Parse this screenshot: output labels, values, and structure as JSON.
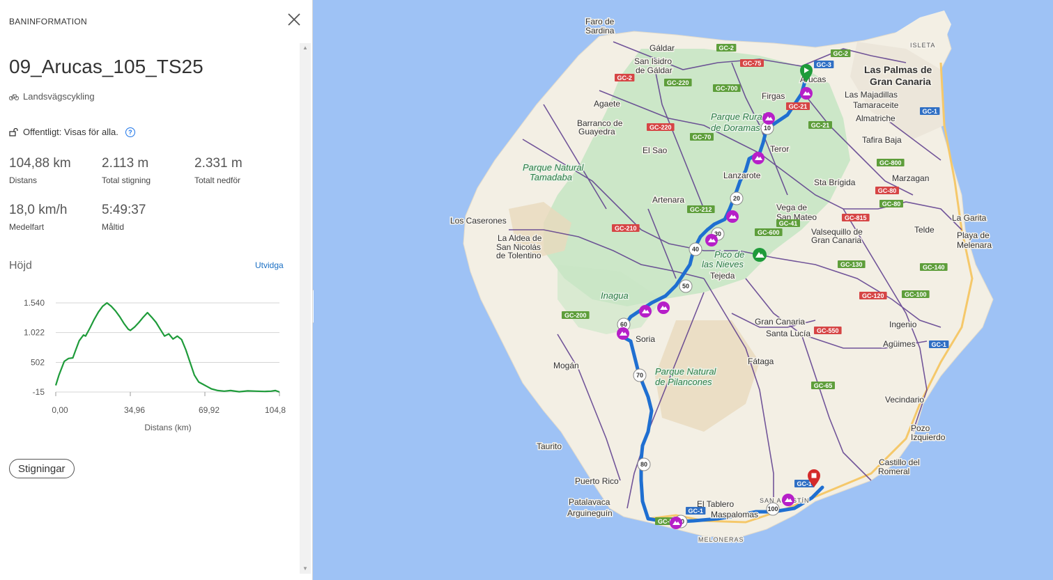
{
  "panel": {
    "header": "BANINFORMATION",
    "route_name": "09_Arucas_105_TS25",
    "activity": "Landsvägscykling",
    "visibility": "Offentligt: Visas för alla.",
    "stats": [
      {
        "value": "104,88 km",
        "label": "Distans"
      },
      {
        "value": "2.113 m",
        "label": "Total stigning"
      },
      {
        "value": "2.331 m",
        "label": "Totalt nedför"
      },
      {
        "value": "18,0 km/h",
        "label": "Medelfart"
      },
      {
        "value": "5:49:37",
        "label": "Måltid"
      }
    ],
    "elevation_title": "Höjd",
    "expand_label": "Utvidga",
    "climbs_button": "Stigningar"
  },
  "chart_data": {
    "type": "line",
    "title": "",
    "xlabel": "Distans (km)",
    "ylabel": "",
    "y_ticks": [
      "1.540",
      "1.022",
      "502",
      "-15"
    ],
    "x_ticks": [
      "0,00",
      "34,96",
      "69,92",
      "104,8"
    ],
    "xlim": [
      0,
      104.88
    ],
    "ylim": [
      -15,
      1540
    ],
    "line_color": "#1e9b3a",
    "series": [
      {
        "x": [
          0,
          1.5,
          4,
          6,
          8,
          9,
          11,
          13,
          14,
          16,
          18,
          20,
          22,
          24,
          26,
          28,
          30,
          32,
          34,
          35,
          37,
          39,
          41,
          43,
          45,
          47,
          49,
          51,
          53,
          55,
          57,
          59,
          61,
          63,
          65,
          67,
          69,
          71,
          73,
          76,
          79,
          82,
          86,
          90,
          94,
          98,
          101,
          103,
          104.88
        ],
        "y": [
          100,
          280,
          520,
          570,
          580,
          680,
          880,
          980,
          960,
          1100,
          1250,
          1380,
          1480,
          1540,
          1480,
          1400,
          1300,
          1180,
          1080,
          1060,
          1120,
          1200,
          1290,
          1370,
          1290,
          1200,
          1080,
          960,
          1000,
          910,
          960,
          900,
          720,
          500,
          280,
          160,
          120,
          80,
          40,
          10,
          0,
          10,
          -10,
          5,
          0,
          -5,
          0,
          10,
          -15
        ]
      }
    ]
  },
  "map": {
    "labels": [
      {
        "t": "Faro de",
        "c": "town"
      },
      {
        "t": "Sardina",
        "c": "town"
      },
      {
        "t": "Gáldar",
        "c": "town"
      },
      {
        "t": "San Isidro",
        "c": "town"
      },
      {
        "t": "de Gáldar",
        "c": "town"
      },
      {
        "t": "Agaete",
        "c": "town"
      },
      {
        "t": "Barranco de",
        "c": "town"
      },
      {
        "t": "Guayedra",
        "c": "town"
      },
      {
        "t": "El Sao",
        "c": "town"
      },
      {
        "t": "Firgas",
        "c": "town"
      },
      {
        "t": "Arucas",
        "c": "town"
      },
      {
        "t": "Las Palmas de",
        "c": "city"
      },
      {
        "t": "Gran Canaria",
        "c": "city"
      },
      {
        "t": "ISLETA",
        "c": "caps"
      },
      {
        "t": "Las Majadillas",
        "c": "town"
      },
      {
        "t": "Tamaraceite",
        "c": "town"
      },
      {
        "t": "Almatriche",
        "c": "town"
      },
      {
        "t": "Tafira Baja",
        "c": "town"
      },
      {
        "t": "Parque Rural",
        "c": "park"
      },
      {
        "t": "de Doramas",
        "c": "park"
      },
      {
        "t": "Parque Natural",
        "c": "park"
      },
      {
        "t": "Tamadaba",
        "c": "park"
      },
      {
        "t": "Teror",
        "c": "town"
      },
      {
        "t": "Lanzarote",
        "c": "town"
      },
      {
        "t": "Sta Brígida",
        "c": "town"
      },
      {
        "t": "Marzagan",
        "c": "town"
      },
      {
        "t": "Artenara",
        "c": "town"
      },
      {
        "t": "Vega de",
        "c": "town"
      },
      {
        "t": "San Mateo",
        "c": "town"
      },
      {
        "t": "Valsequillo de",
        "c": "town"
      },
      {
        "t": "Gran Canaria",
        "c": "town"
      },
      {
        "t": "Telde",
        "c": "town"
      },
      {
        "t": "La Garita",
        "c": "town"
      },
      {
        "t": "Playa de",
        "c": "town"
      },
      {
        "t": "Melenara",
        "c": "town"
      },
      {
        "t": "Los Caserones",
        "c": "town"
      },
      {
        "t": "La Aldea de",
        "c": "town"
      },
      {
        "t": "San Nicolás",
        "c": "town"
      },
      {
        "t": "de Tolentino",
        "c": "town"
      },
      {
        "t": "Pico de",
        "c": "park"
      },
      {
        "t": "las Nieves",
        "c": "park"
      },
      {
        "t": "Tejeda",
        "c": "town"
      },
      {
        "t": "Inagua",
        "c": "park"
      },
      {
        "t": "Soria",
        "c": "town"
      },
      {
        "t": "Mogán",
        "c": "town"
      },
      {
        "t": "Parque Natural",
        "c": "park"
      },
      {
        "t": "de Pilancones",
        "c": "park"
      },
      {
        "t": "Gran Canaria",
        "c": "town"
      },
      {
        "t": "Santa Lucía",
        "c": "town"
      },
      {
        "t": "Fátaga",
        "c": "town"
      },
      {
        "t": "Ingenio",
        "c": "town"
      },
      {
        "t": "Agüimes",
        "c": "town"
      },
      {
        "t": "Vecindario",
        "c": "town"
      },
      {
        "t": "Pozo",
        "c": "town"
      },
      {
        "t": "Izquierdo",
        "c": "town"
      },
      {
        "t": "Castillo del",
        "c": "town"
      },
      {
        "t": "Romeral",
        "c": "town"
      },
      {
        "t": "Tauritо",
        "c": "town"
      },
      {
        "t": "Puerto Rico",
        "c": "town"
      },
      {
        "t": "Patalavaca",
        "c": "town"
      },
      {
        "t": "Arguineguín",
        "c": "town"
      },
      {
        "t": "El Tablero",
        "c": "town"
      },
      {
        "t": "Maspalomas",
        "c": "town"
      },
      {
        "t": "MELONERAS",
        "c": "caps"
      },
      {
        "t": "SAN AGUSTÍN",
        "c": "caps"
      }
    ],
    "roads": [
      "GC-2",
      "GC-75",
      "GC-3",
      "GC-2",
      "GC-2",
      "GC-220",
      "GC-700",
      "GC-21",
      "GC-1",
      "GC-21",
      "GC-220",
      "GC-70",
      "GC-800",
      "GC-80",
      "GC-80",
      "GC-212",
      "GC-210",
      "GC-600",
      "GC-41",
      "GC-815",
      "GC-130",
      "GC-140",
      "GC-120",
      "GC-100",
      "GC-200",
      "GC-550",
      "GC-65",
      "GC-1",
      "GC-1",
      "GC-1",
      "GC-500"
    ],
    "km_markers": [
      "10",
      "20",
      "30",
      "40",
      "50",
      "60",
      "70",
      "80",
      "90",
      "100"
    ]
  }
}
